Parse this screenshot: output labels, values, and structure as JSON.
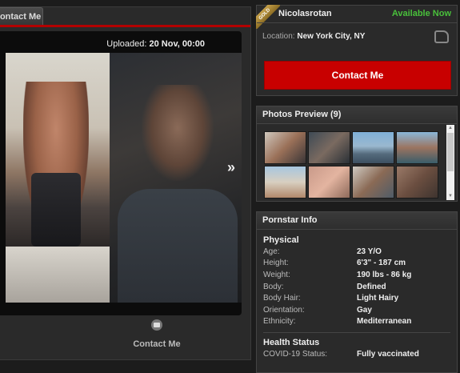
{
  "gallery": {
    "tab_label": "Contact Me",
    "uploaded_label": "Uploaded:",
    "uploaded_date": "20 Nov, 00:00",
    "next_arrow": "»",
    "contact_label": "Contact Me",
    "contact_icon": "envelope-icon"
  },
  "profile": {
    "badge": "GOLD",
    "name": "Nicolasrotan",
    "availability": "Available Now",
    "location_label": "Location:",
    "location_value": "New York City, NY",
    "contact_button": "Contact Me",
    "colors": {
      "available": "#49c03b",
      "contact_bg": "#c80000",
      "badge": "#b8923a"
    }
  },
  "photos": {
    "title": "Photos Preview (9)"
  },
  "info": {
    "title": "Pornstar Info",
    "physical_title": "Physical",
    "physical": [
      {
        "key": "Age:",
        "value": "23 Y/O"
      },
      {
        "key": "Height:",
        "value": "6'3\" - 187 cm"
      },
      {
        "key": "Weight:",
        "value": "190 lbs - 86 kg"
      },
      {
        "key": "Body:",
        "value": "Defined"
      },
      {
        "key": "Body Hair:",
        "value": "Light Hairy"
      },
      {
        "key": "Orientation:",
        "value": "Gay"
      },
      {
        "key": "Ethnicity:",
        "value": "Mediterranean"
      }
    ],
    "health_title": "Health Status",
    "health": [
      {
        "key": "COVID-19 Status:",
        "value": "Fully vaccinated"
      }
    ]
  }
}
